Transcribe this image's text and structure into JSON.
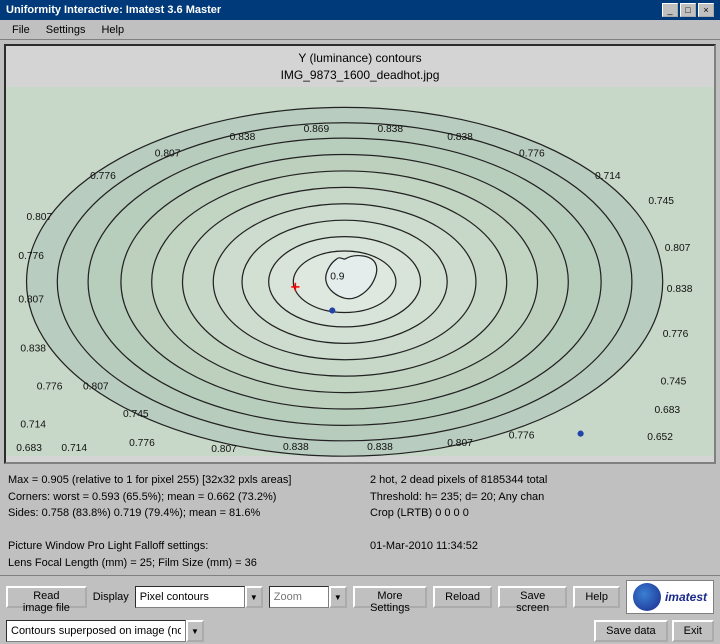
{
  "window": {
    "title": "Uniformity Interactive: Imatest 3.6 Master"
  },
  "menu": {
    "items": [
      "File",
      "Settings",
      "Help"
    ]
  },
  "chart": {
    "title_line1": "Y (luminance) contours",
    "title_line2": "IMG_9873_1600_deadhot.jpg",
    "contour_values": [
      "0.776",
      "0.807",
      "0.838",
      "0.869",
      "0.9",
      "0.9",
      "0.869",
      "0.838",
      "0.807",
      "0.776",
      "0.745",
      "0.714",
      "0.683",
      "0.652"
    ],
    "center_label": "0.9"
  },
  "info": {
    "left": {
      "line1": "Max = 0.905  (relative to 1 for pixel 255) [32x32 pxls areas]",
      "line2": "Corners: worst = 0.593 (65.5%);  mean = 0.662 (73.2%)",
      "line3": "Sides: 0.758 (83.8%)  0.719 (79.4%);  mean = 81.6%",
      "line4": "",
      "line5": "Picture Window Pro Light Falloff settings:",
      "line6": "Lens Focal Length (mm) = 25;  Film Size (mm) = 36"
    },
    "right": {
      "line1": "2 hot, 2 dead pixels of  8185344  total",
      "line2": "Threshold: h= 235; d= 20;  Any chan",
      "line3": "Crop (LRTB)  0  0  0  0",
      "line4": "",
      "line5": "01-Mar-2010 11:34:52"
    }
  },
  "toolbar": {
    "read_image_label": "Read image file",
    "display_label": "Display",
    "display_value": "Pixel contours",
    "zoom_label": "Zoom",
    "zoom_value": "",
    "more_settings_label": "More Settings",
    "reload_label": "Reload",
    "save_screen_label": "Save screen",
    "save_data_label": "Save data",
    "help_label": "Help",
    "exit_label": "Exit"
  },
  "status": {
    "value": "Contours superposed on image (not normiz.)"
  },
  "logo": {
    "text": "imatest"
  },
  "titlebar": {
    "minimize": "_",
    "maximize": "□",
    "close": "×"
  }
}
